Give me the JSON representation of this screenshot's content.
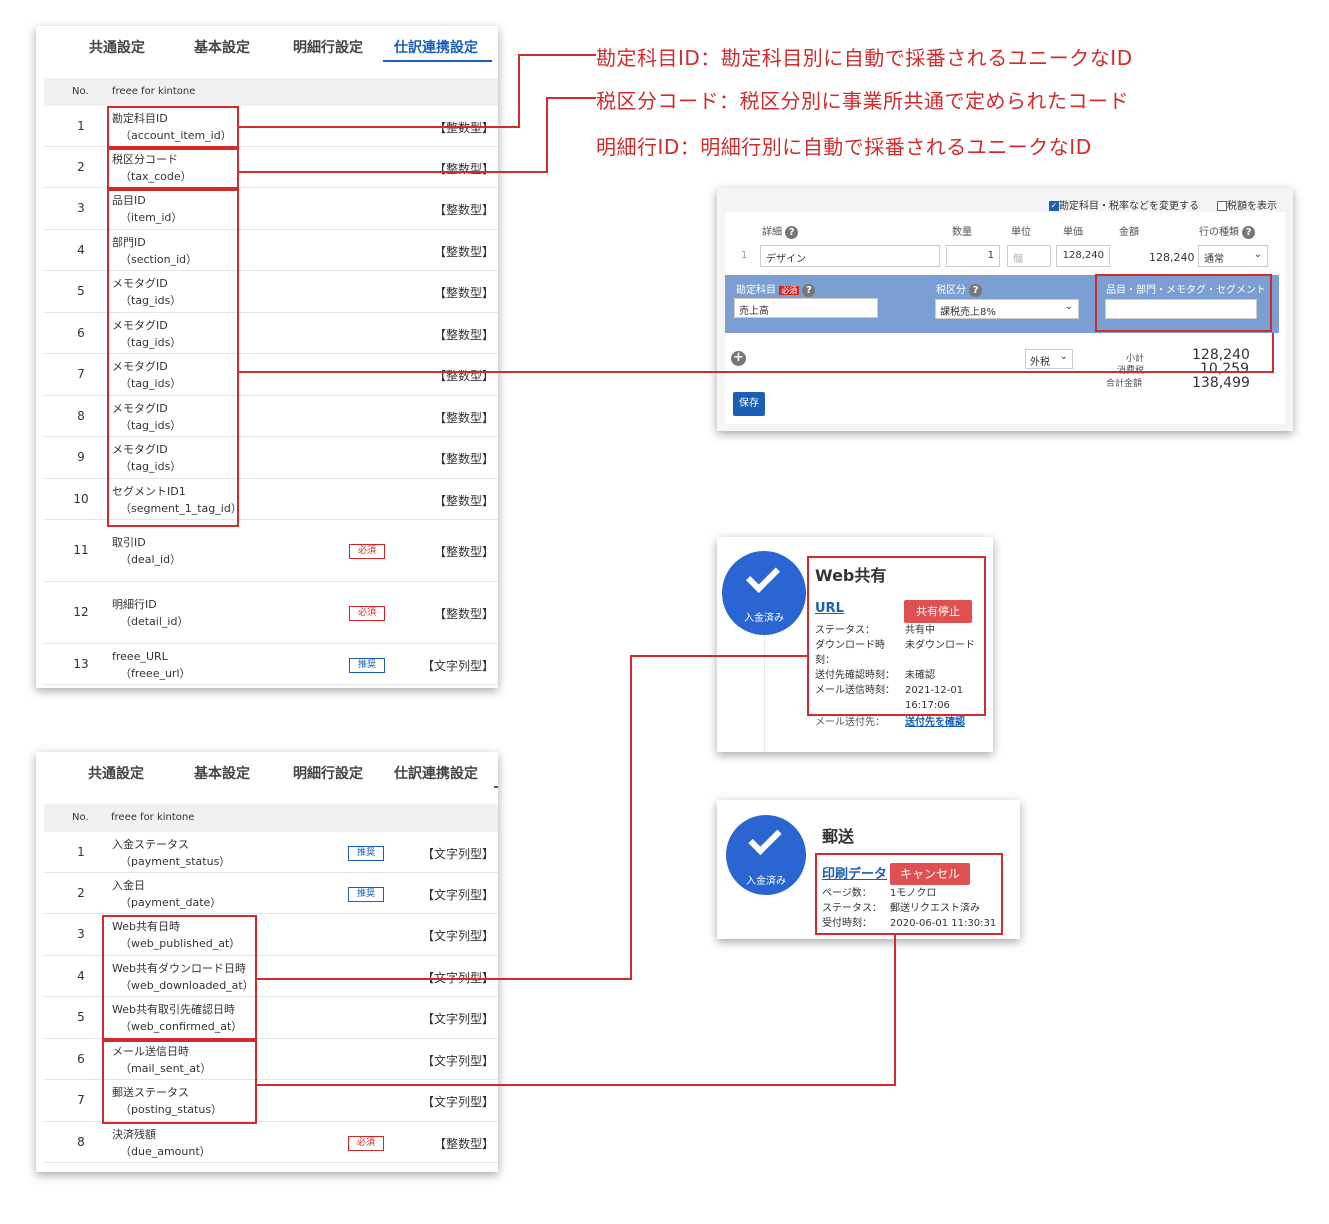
{
  "notes": {
    "account_item": "勘定科目ID：勘定科目別に自動で採番されるユニークなID",
    "tax_code": "税区分コード：税区分別に事業所共通で定められたコード",
    "detail": "明細行ID：明細行別に自動で採番されるユニークなID"
  },
  "tabs": [
    "共通設定",
    "基本設定",
    "明細行設定",
    "仕訳連携設定"
  ],
  "table_head": {
    "no": "No.",
    "name": "freee for kintone"
  },
  "panel1_rows": [
    {
      "no": "1",
      "name": "勘定科目ID",
      "code": "（account_item_id）",
      "type": "【整数型】",
      "badge": ""
    },
    {
      "no": "2",
      "name": "税区分コード",
      "code": "（tax_code）",
      "type": "【整数型】",
      "badge": ""
    },
    {
      "no": "3",
      "name": "品目ID",
      "code": "（item_id）",
      "type": "【整数型】",
      "badge": ""
    },
    {
      "no": "4",
      "name": "部門ID",
      "code": "（section_id）",
      "type": "【整数型】",
      "badge": ""
    },
    {
      "no": "5",
      "name": "メモタグID",
      "code": "（tag_ids）",
      "type": "【整数型】",
      "badge": ""
    },
    {
      "no": "6",
      "name": "メモタグID",
      "code": "（tag_ids）",
      "type": "【整数型】",
      "badge": ""
    },
    {
      "no": "7",
      "name": "メモタグID",
      "code": "（tag_ids）",
      "type": "【整数型】",
      "badge": ""
    },
    {
      "no": "8",
      "name": "メモタグID",
      "code": "（tag_ids）",
      "type": "【整数型】",
      "badge": ""
    },
    {
      "no": "9",
      "name": "メモタグID",
      "code": "（tag_ids）",
      "type": "【整数型】",
      "badge": ""
    },
    {
      "no": "10",
      "name": "セグメントID1",
      "code": "（segment_1_tag_id）",
      "type": "【整数型】",
      "badge": ""
    },
    {
      "no": "11",
      "name": "取引ID",
      "code": "（deal_id）",
      "type": "【整数型】",
      "badge": "必須"
    },
    {
      "no": "12",
      "name": "明細行ID",
      "code": "（detail_id）",
      "type": "【整数型】",
      "badge": "必須"
    },
    {
      "no": "13",
      "name": "freee_URL",
      "code": "（freee_url）",
      "type": "【文字列型】",
      "badge": "推奨"
    }
  ],
  "panel2_rows": [
    {
      "no": "1",
      "name": "入金ステータス",
      "code": "（payment_status）",
      "type": "【文字列型】",
      "badge": "推奨"
    },
    {
      "no": "2",
      "name": "入金日",
      "code": "（payment_date）",
      "type": "【文字列型】",
      "badge": "推奨"
    },
    {
      "no": "3",
      "name": "Web共有日時",
      "code": "（web_published_at）",
      "type": "【文字列型】",
      "badge": ""
    },
    {
      "no": "4",
      "name": "Web共有ダウンロード日時",
      "code": "（web_downloaded_at）",
      "type": "【文字列型】",
      "badge": ""
    },
    {
      "no": "5",
      "name": "Web共有取引先確認日時",
      "code": "（web_confirmed_at）",
      "type": "【文字列型】",
      "badge": ""
    },
    {
      "no": "6",
      "name": "メール送信日時",
      "code": "（mail_sent_at）",
      "type": "【文字列型】",
      "badge": ""
    },
    {
      "no": "7",
      "name": "郵送ステータス",
      "code": "（posting_status）",
      "type": "【文字列型】",
      "badge": ""
    },
    {
      "no": "8",
      "name": "決済残額",
      "code": "（due_amount）",
      "type": "【整数型】",
      "badge": "必須"
    }
  ],
  "form": {
    "change_cb": "勘定科目・税率などを変更する",
    "tax_cb": "税額を表示",
    "col_detail": "詳細",
    "col_qty": "数量",
    "col_unit": "単位",
    "col_price": "単価",
    "col_amount": "金額",
    "col_type": "行の種類",
    "row_no": "1",
    "detail_value": "デザイン",
    "qty_value": "1",
    "unit_placeholder": "個",
    "price_value": "128,240",
    "amount_value": "128,240",
    "row_type": "通常",
    "account_label": "勘定科目",
    "required": "必須",
    "account_value": "売上高",
    "tax_label": "税区分",
    "tax_value": "課税売上8%",
    "item_label": "品目・部門・メモタグ・セグメント",
    "tax_mode": "外税",
    "subtotal_label": "小計",
    "subtotal_value": "128,240",
    "tax_amount_label": "消費税",
    "tax_amount_value": "10,259",
    "total_label": "合計金額",
    "total_value": "138,499",
    "save": "保存"
  },
  "web_share": {
    "paid": "入金済み",
    "title": "Web共有",
    "url": "URL",
    "stop": "共有停止",
    "status_label": "ステータス：",
    "status_value": "共有中",
    "download_label": "ダウンロード時",
    "download_label2": "刻：",
    "download_value": "未ダウンロード",
    "confirm_label": "送付先確認時刻：",
    "confirm_value": "未確認",
    "mail_label": "メール送信時刻：",
    "mail_value": "2021-12-01",
    "mail_time": "16:17:06",
    "recipient_label": "メール送付先：",
    "recipient_link": "送付先を確認"
  },
  "postal": {
    "paid": "入金済み",
    "title": "郵送",
    "print_link": "印刷データ",
    "cancel": "キャンセル",
    "pages_label": "ページ数：",
    "pages_value": "1モノクロ",
    "status_label": "ステータス：",
    "status_value": "郵送リクエスト済み",
    "received_label": "受付時刻：",
    "received_value": "2020-06-01 11:30:31"
  },
  "colors": {
    "accent_red": "#d12b2b",
    "link_blue": "#1a5fb4",
    "paid_blue": "#2a65d1",
    "band_blue": "#7b9ed3"
  }
}
